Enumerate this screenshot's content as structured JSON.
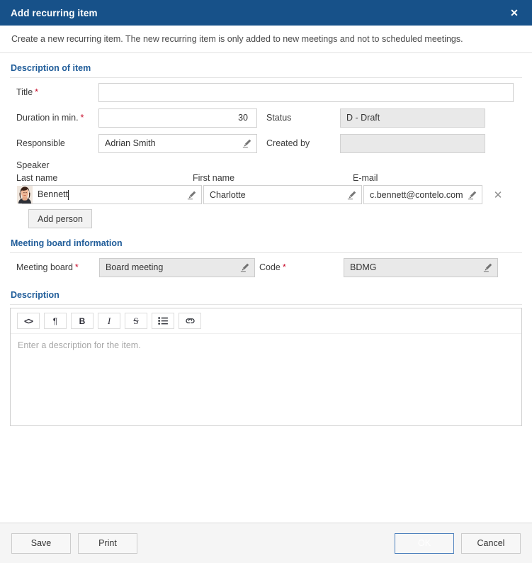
{
  "titlebar": {
    "title": "Add recurring item",
    "close_label": "✕"
  },
  "intro": {
    "text": "Create a new recurring item. The new recurring item is only added to new meetings and not to scheduled meetings."
  },
  "sections": {
    "description_of_item": {
      "title": "Description of item",
      "fields": {
        "title": {
          "label": "Title",
          "required": "*",
          "value": "",
          "placeholder": ""
        },
        "duration": {
          "label": "Duration in min.",
          "required": "*",
          "value": "30"
        },
        "responsible": {
          "label": "Responsible",
          "required": "",
          "value": "Adrian Smith"
        },
        "status": {
          "label": "Status",
          "required": "",
          "value": "D - Draft"
        },
        "created_by": {
          "label": "Created by",
          "required": "",
          "value": ""
        }
      }
    },
    "speaker": {
      "caption": "Speaker",
      "columns": {
        "last_name": "Last name",
        "first_name": "First name",
        "email": "E-mail"
      },
      "rows": [
        {
          "last_name": "Bennett",
          "first_name": "Charlotte",
          "email": "c.bennett@contelo.com",
          "delete_label": "✕"
        }
      ],
      "add_person_label": "Add person"
    },
    "meeting_board_information": {
      "title": "Meeting board information",
      "fields": {
        "meeting_board": {
          "label": "Meeting board",
          "required": "*",
          "value": "Board meeting"
        },
        "code": {
          "label": "Code",
          "required": "*",
          "value": "BDMG"
        }
      }
    },
    "description": {
      "title": "Description",
      "toolbar": [
        {
          "name": "code-block",
          "label": "<>"
        },
        {
          "name": "paragraph",
          "label": "¶"
        },
        {
          "name": "bold",
          "label": "B"
        },
        {
          "name": "italic",
          "label": "I"
        },
        {
          "name": "strikethrough",
          "label": "S"
        },
        {
          "name": "bullet-list",
          "label": "☰"
        },
        {
          "name": "link",
          "label": "∞"
        }
      ],
      "placeholder": "Enter a description for the item.",
      "value": ""
    }
  },
  "footer": {
    "save_label": "Save",
    "print_label": "Print",
    "ok_label": "OK",
    "cancel_label": "Cancel"
  },
  "colors": {
    "titlebar_bg": "#175189",
    "section_heading": "#1f5c99",
    "required_marker": "#c8102e",
    "primary_button": "#4d80bd",
    "readonly_field": "#e9e9e9"
  }
}
